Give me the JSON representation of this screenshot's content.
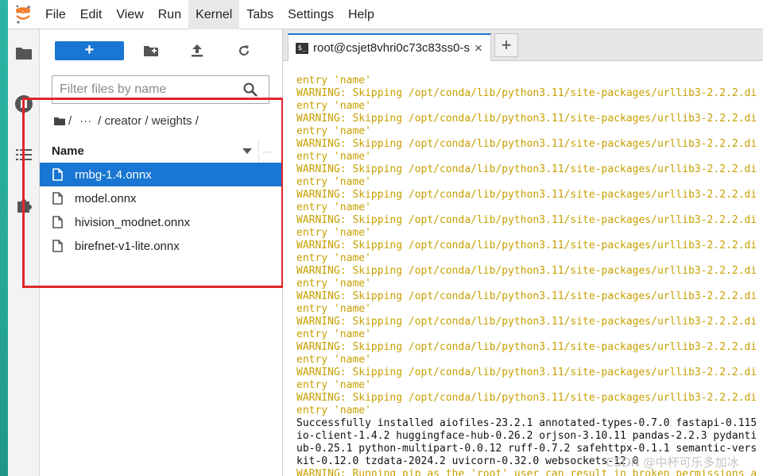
{
  "menu": {
    "items": [
      "File",
      "Edit",
      "View",
      "Run",
      "Kernel",
      "Tabs",
      "Settings",
      "Help"
    ],
    "active": "Kernel"
  },
  "activity_icons": [
    "folder-icon",
    "running-icon",
    "toc-icon",
    "extension-icon"
  ],
  "filebrowser": {
    "new_label": "+",
    "filter_placeholder": "Filter files by name",
    "breadcrumb": [
      "/",
      "···",
      "/ creator / weights /"
    ],
    "header_name": "Name",
    "header_more": "···",
    "files": [
      {
        "name": "rmbg-1.4.onnx",
        "selected": true
      },
      {
        "name": "model.onnx",
        "selected": false
      },
      {
        "name": "hivision_modnet.onnx",
        "selected": false
      },
      {
        "name": "birefnet-v1-lite.onnx",
        "selected": false
      }
    ]
  },
  "terminal": {
    "tab_title": "root@csjet8vhri0c73c83ss0-s",
    "tab_close": "×",
    "add_tab": "+",
    "lines": [
      {
        "text": "entry 'name'",
        "kind": "warn"
      },
      {
        "text": "WARNING: Skipping /opt/conda/lib/python3.11/site-packages/urllib3-2.2.2.di",
        "kind": "warn"
      },
      {
        "text": "entry 'name'",
        "kind": "warn"
      },
      {
        "text": "WARNING: Skipping /opt/conda/lib/python3.11/site-packages/urllib3-2.2.2.di",
        "kind": "warn"
      },
      {
        "text": "entry 'name'",
        "kind": "warn"
      },
      {
        "text": "WARNING: Skipping /opt/conda/lib/python3.11/site-packages/urllib3-2.2.2.di",
        "kind": "warn"
      },
      {
        "text": "entry 'name'",
        "kind": "warn"
      },
      {
        "text": "WARNING: Skipping /opt/conda/lib/python3.11/site-packages/urllib3-2.2.2.di",
        "kind": "warn"
      },
      {
        "text": "entry 'name'",
        "kind": "warn"
      },
      {
        "text": "WARNING: Skipping /opt/conda/lib/python3.11/site-packages/urllib3-2.2.2.di",
        "kind": "warn"
      },
      {
        "text": "entry 'name'",
        "kind": "warn"
      },
      {
        "text": "WARNING: Skipping /opt/conda/lib/python3.11/site-packages/urllib3-2.2.2.di",
        "kind": "warn"
      },
      {
        "text": "entry 'name'",
        "kind": "warn"
      },
      {
        "text": "WARNING: Skipping /opt/conda/lib/python3.11/site-packages/urllib3-2.2.2.di",
        "kind": "warn"
      },
      {
        "text": "entry 'name'",
        "kind": "warn"
      },
      {
        "text": "WARNING: Skipping /opt/conda/lib/python3.11/site-packages/urllib3-2.2.2.di",
        "kind": "warn"
      },
      {
        "text": "entry 'name'",
        "kind": "warn"
      },
      {
        "text": "WARNING: Skipping /opt/conda/lib/python3.11/site-packages/urllib3-2.2.2.di",
        "kind": "warn"
      },
      {
        "text": "entry 'name'",
        "kind": "warn"
      },
      {
        "text": "WARNING: Skipping /opt/conda/lib/python3.11/site-packages/urllib3-2.2.2.di",
        "kind": "warn"
      },
      {
        "text": "entry 'name'",
        "kind": "warn"
      },
      {
        "text": "WARNING: Skipping /opt/conda/lib/python3.11/site-packages/urllib3-2.2.2.di",
        "kind": "warn"
      },
      {
        "text": "entry 'name'",
        "kind": "warn"
      },
      {
        "text": "WARNING: Skipping /opt/conda/lib/python3.11/site-packages/urllib3-2.2.2.di",
        "kind": "warn"
      },
      {
        "text": "entry 'name'",
        "kind": "warn"
      },
      {
        "text": "WARNING: Skipping /opt/conda/lib/python3.11/site-packages/urllib3-2.2.2.di",
        "kind": "warn"
      },
      {
        "text": "entry 'name'",
        "kind": "warn"
      },
      {
        "text": "Successfully installed aiofiles-23.2.1 annotated-types-0.7.0 fastapi-0.115",
        "kind": "normal"
      },
      {
        "text": "io-client-1.4.2 huggingface-hub-0.26.2 orjson-3.10.11 pandas-2.2.3 pydanti",
        "kind": "normal"
      },
      {
        "text": "ub-0.25.1 python-multipart-0.0.12 ruff-0.7.2 safehttpx-0.1.1 semantic-vers",
        "kind": "normal"
      },
      {
        "text": "kit-0.12.0 tzdata-2024.2 uvicorn-0.32.0 websockets-12.0",
        "kind": "normal"
      },
      {
        "text": "WARNING: Running pip as the 'root' user can result in broken permissions a",
        "kind": "warn"
      }
    ]
  },
  "watermark": "CSDN @中杯可乐多加冰",
  "colors": {
    "accent": "#1976d2",
    "warning_text": "#c7a000",
    "highlight_box": "#e0262b",
    "jupyter_orange": "#f37726"
  }
}
